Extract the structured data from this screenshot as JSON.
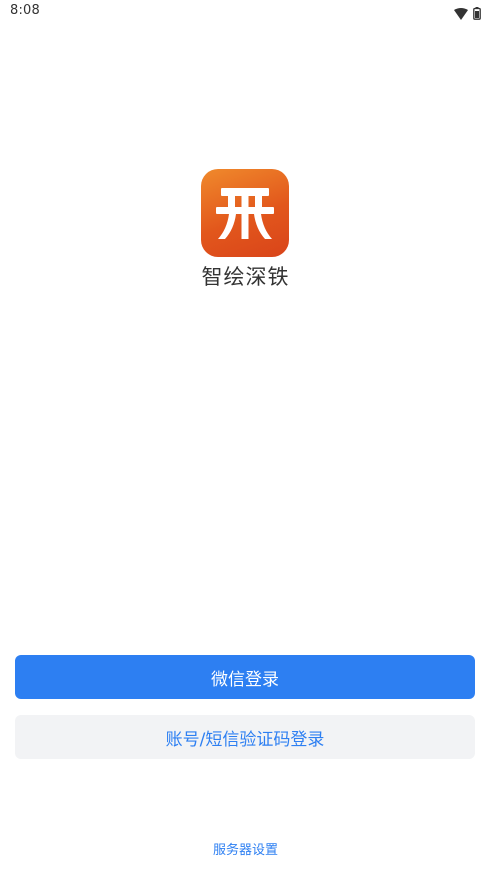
{
  "status_bar": {
    "time": "8:08",
    "icons": [
      "wifi-icon",
      "battery-icon"
    ]
  },
  "app": {
    "logo_icon": "metro-logo-icon",
    "name": "智绘深铁"
  },
  "actions": {
    "wechat_login_label": "微信登录",
    "account_login_label": "账号/短信验证码登录",
    "server_settings_label": "服务器设置"
  },
  "colors": {
    "primary": "#2d7ff2",
    "secondary_button_bg": "#f2f3f5",
    "logo_orange": "#e8601f",
    "text": "#333333"
  }
}
